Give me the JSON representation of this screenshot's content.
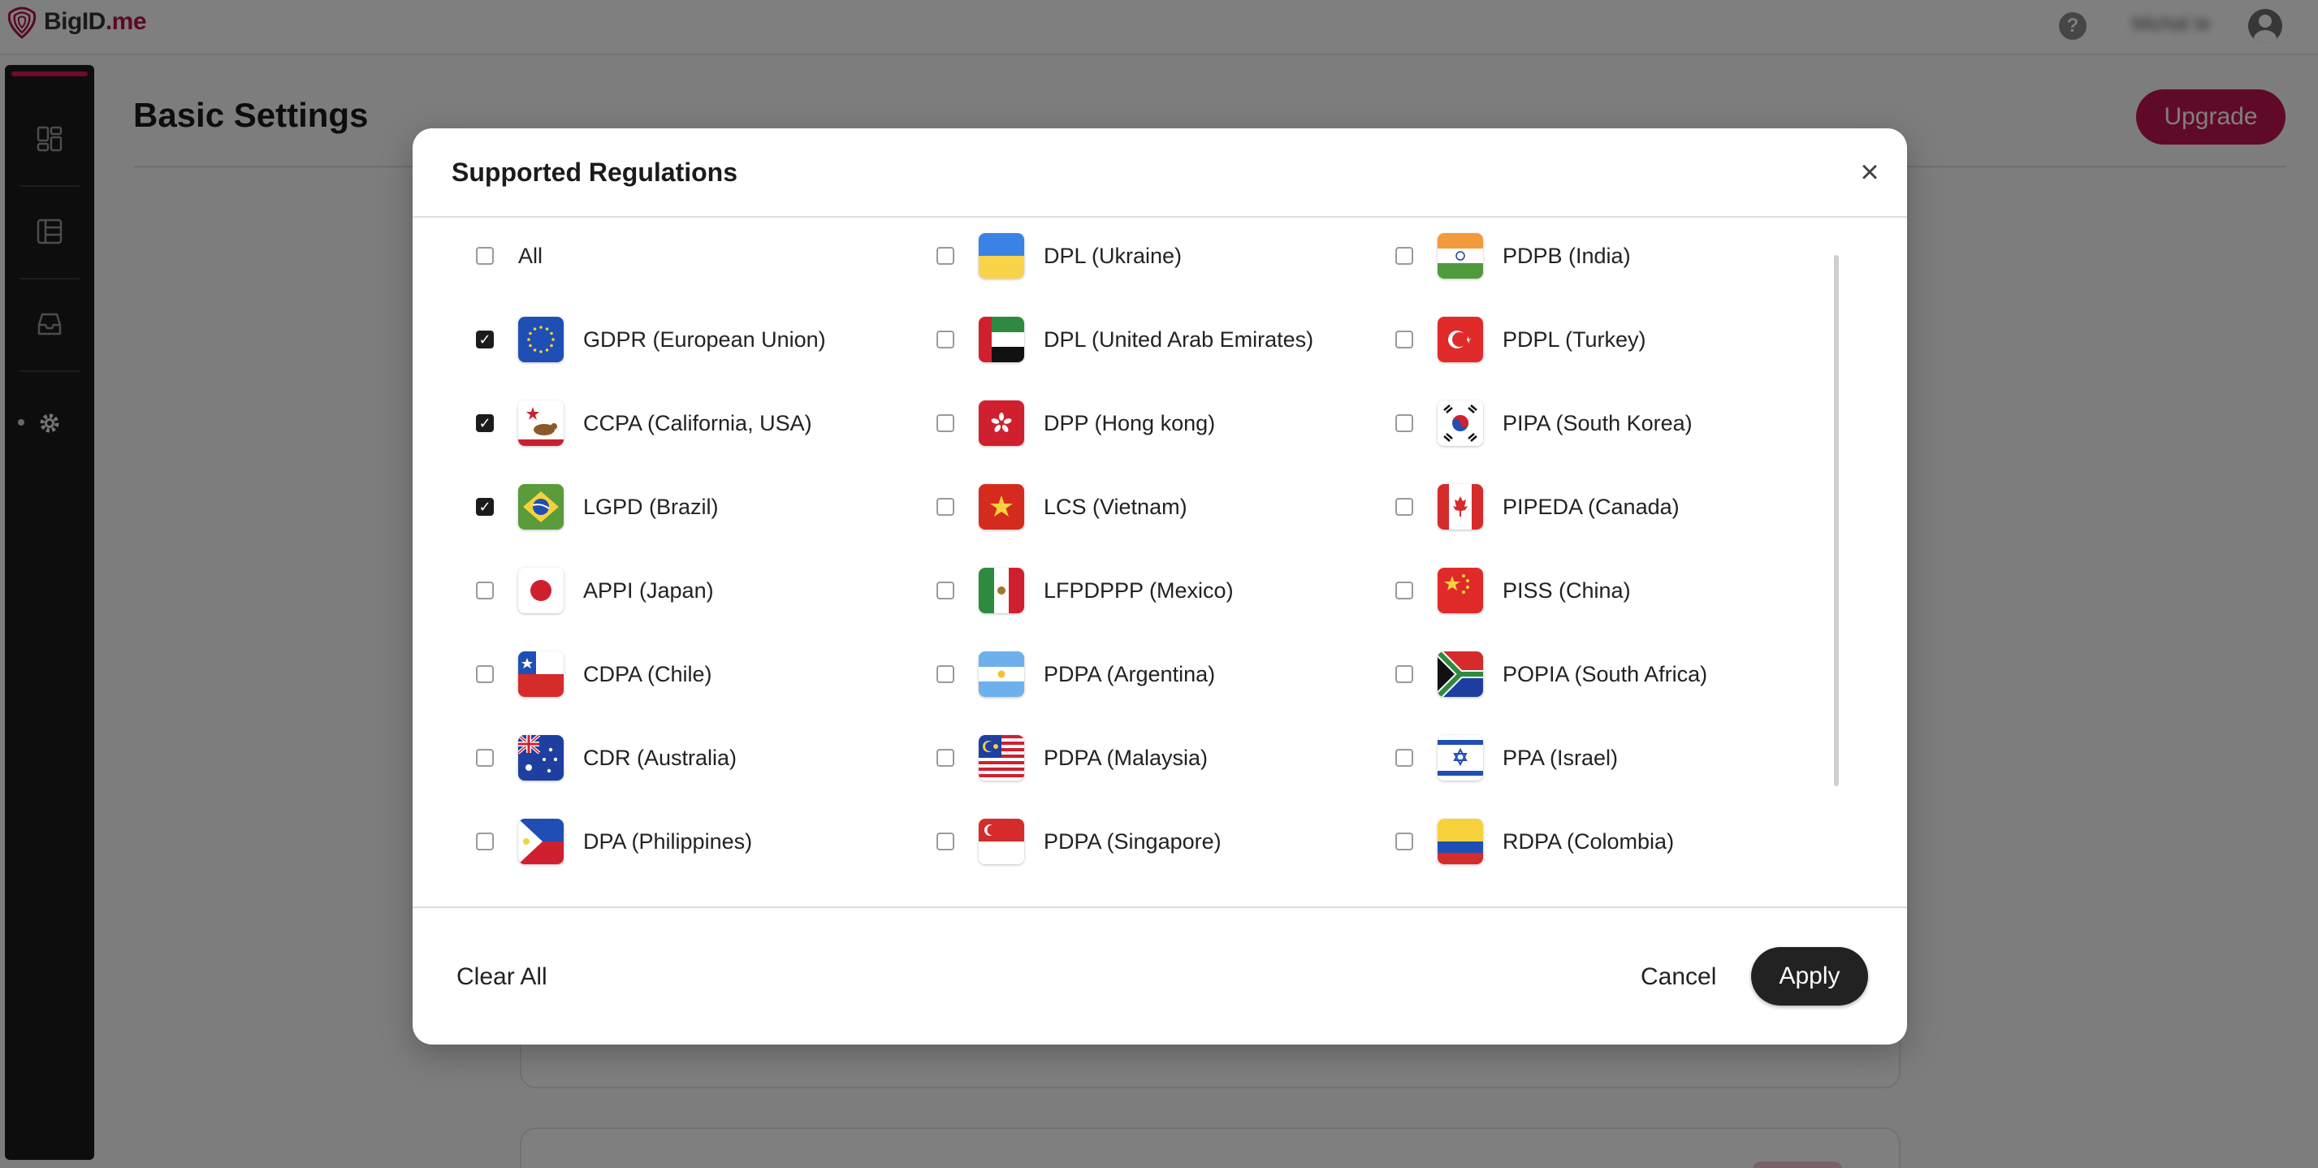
{
  "app": {
    "logo_text": "BigID",
    "logo_suffix": ".me",
    "help_icon": "question-circle-icon",
    "user_name": "Michal Ie",
    "avatar_icon": "user-circle-icon"
  },
  "sidebar": {
    "items": [
      {
        "name": "dashboard",
        "icon": "dashboard-icon"
      },
      {
        "name": "catalog",
        "icon": "table-icon"
      },
      {
        "name": "inbox",
        "icon": "inbox-icon"
      },
      {
        "name": "settings",
        "icon": "gear-icon",
        "active": true
      }
    ]
  },
  "page": {
    "title": "Basic Settings",
    "upgrade_label": "Upgrade"
  },
  "modal": {
    "title": "Supported Regulations",
    "close_icon": "close-icon",
    "all_label": "All",
    "all_checked": false,
    "columns": [
      [
        {
          "label": "GDPR (European Union)",
          "flag": "eu",
          "checked": true
        },
        {
          "label": "CCPA (California, USA)",
          "flag": "california",
          "checked": true
        },
        {
          "label": "LGPD (Brazil)",
          "flag": "brazil",
          "checked": true
        },
        {
          "label": "APPI (Japan)",
          "flag": "japan",
          "checked": false
        },
        {
          "label": "CDPA (Chile)",
          "flag": "chile",
          "checked": false
        },
        {
          "label": "CDR (Australia)",
          "flag": "australia",
          "checked": false
        },
        {
          "label": "DPA (Philippines)",
          "flag": "philippines",
          "checked": false
        }
      ],
      [
        {
          "label": "DPL (Ukraine)",
          "flag": "ukraine",
          "checked": false
        },
        {
          "label": "DPL (United Arab Emirates)",
          "flag": "uae",
          "checked": false
        },
        {
          "label": "DPP (Hong kong)",
          "flag": "hongkong",
          "checked": false
        },
        {
          "label": "LCS (Vietnam)",
          "flag": "vietnam",
          "checked": false
        },
        {
          "label": "LFPDPPP (Mexico)",
          "flag": "mexico",
          "checked": false
        },
        {
          "label": "PDPA (Argentina)",
          "flag": "argentina",
          "checked": false
        },
        {
          "label": "PDPA (Malaysia)",
          "flag": "malaysia",
          "checked": false
        },
        {
          "label": "PDPA (Singapore)",
          "flag": "singapore",
          "checked": false
        }
      ],
      [
        {
          "label": "PDPB (India)",
          "flag": "india",
          "checked": false
        },
        {
          "label": "PDPL (Turkey)",
          "flag": "turkey",
          "checked": false
        },
        {
          "label": "PIPA (South Korea)",
          "flag": "southkorea",
          "checked": false
        },
        {
          "label": "PIPEDA (Canada)",
          "flag": "canada",
          "checked": false
        },
        {
          "label": "PISS (China)",
          "flag": "china",
          "checked": false
        },
        {
          "label": "POPIA (South Africa)",
          "flag": "southafrica",
          "checked": false
        },
        {
          "label": "PPA (Israel)",
          "flag": "israel",
          "checked": false
        },
        {
          "label": "RDPA (Colombia)",
          "flag": "colombia",
          "checked": false
        }
      ]
    ],
    "footer": {
      "clear_label": "Clear All",
      "cancel_label": "Cancel",
      "apply_label": "Apply"
    }
  }
}
